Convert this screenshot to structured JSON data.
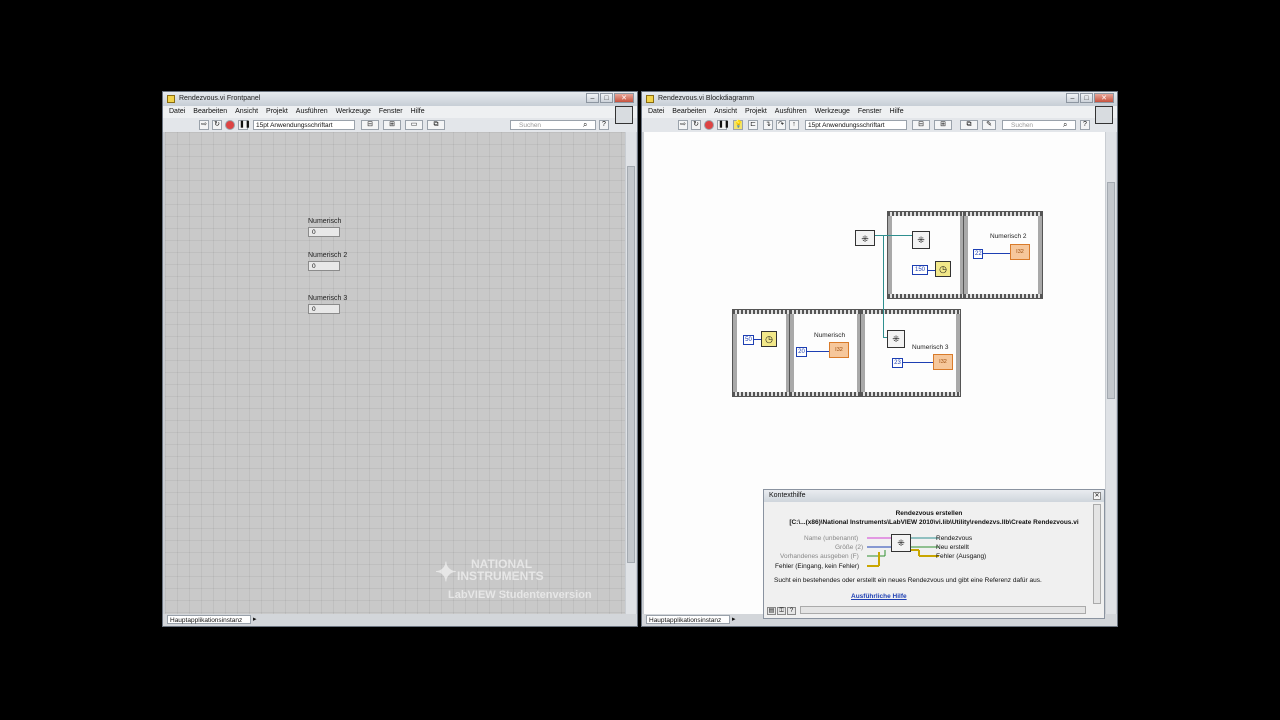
{
  "front_panel": {
    "title": "Rendezvous.vi Frontpanel",
    "menu": [
      "Datei",
      "Bearbeiten",
      "Ansicht",
      "Projekt",
      "Ausführen",
      "Werkzeuge",
      "Fenster",
      "Hilfe"
    ],
    "font_select": "15pt Anwendungsschriftart",
    "search_placeholder": "Suchen",
    "controls": [
      {
        "label": "Numerisch",
        "value": "0"
      },
      {
        "label": "Numerisch 2",
        "value": "0"
      },
      {
        "label": "Numerisch 3",
        "value": "0"
      }
    ],
    "watermark": {
      "line1": "NATIONAL",
      "line2": "INSTRUMENTS",
      "line3": "LabVIEW Studentenversion"
    },
    "status": "Hauptapplikationsinstanz"
  },
  "block_diagram": {
    "title": "Rendezvous.vi Blockdiagramm",
    "menu": [
      "Datei",
      "Bearbeiten",
      "Ansicht",
      "Projekt",
      "Ausführen",
      "Werkzeuge",
      "Fenster",
      "Hilfe"
    ],
    "font_select": "15pt Anwendungsschriftart",
    "search_placeholder": "Suchen",
    "constants": {
      "c150": "150",
      "c22": "22",
      "c50": "50",
      "c20": "20",
      "c23": "23"
    },
    "indicators": {
      "ind_label_2": "Numerisch 2",
      "ind_label_1": "Numerisch",
      "ind_label_3": "Numerisch 3",
      "ind_text": "I32"
    },
    "status": "Hauptapplikationsinstanz"
  },
  "context_help": {
    "title": "Kontexthilfe",
    "heading": "Rendezvous erstellen",
    "path": "[C:\\...(x86)\\National Instruments\\LabVIEW 2010\\vi.lib\\Utility\\rendezvs.llb\\Create Rendezvous.vi",
    "inputs": [
      "Name (unbenannt)",
      "Größe (2)",
      "Vorhandenes ausgeben (F)",
      "Fehler (Eingang, kein Fehler)"
    ],
    "outputs": [
      "Rendezvous",
      "Neu erstellt",
      "Fehler (Ausgang)"
    ],
    "description": "Sucht ein bestehendes oder erstellt ein neues Rendezvous und gibt eine Referenz dafür aus.",
    "link": "Ausführliche Hilfe"
  },
  "colors": {
    "wire_numeric": "#1d3fb3",
    "wire_refnum": "#2f8f8f",
    "indicator": "#d97b2a"
  }
}
